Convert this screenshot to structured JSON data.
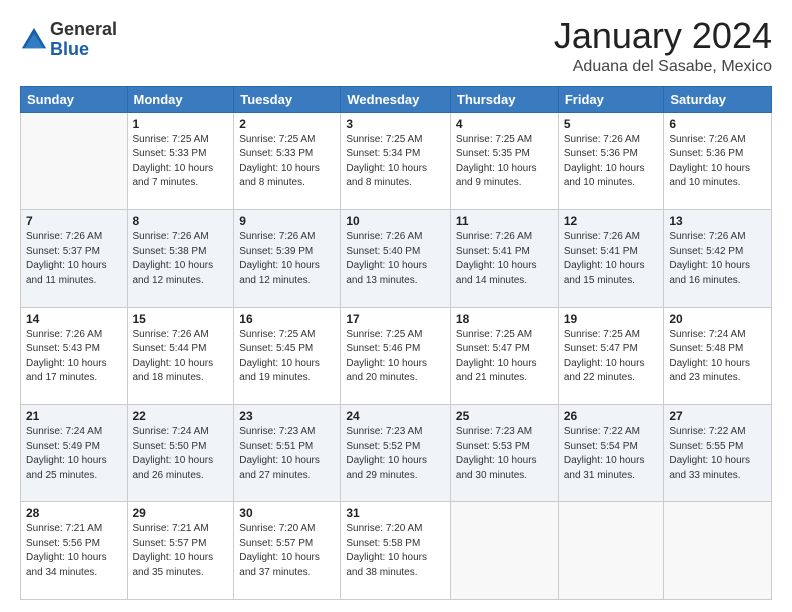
{
  "logo": {
    "general": "General",
    "blue": "Blue"
  },
  "header": {
    "month": "January 2024",
    "location": "Aduana del Sasabe, Mexico"
  },
  "weekdays": [
    "Sunday",
    "Monday",
    "Tuesday",
    "Wednesday",
    "Thursday",
    "Friday",
    "Saturday"
  ],
  "weeks": [
    [
      {
        "day": "",
        "info": ""
      },
      {
        "day": "1",
        "info": "Sunrise: 7:25 AM\nSunset: 5:33 PM\nDaylight: 10 hours\nand 7 minutes."
      },
      {
        "day": "2",
        "info": "Sunrise: 7:25 AM\nSunset: 5:33 PM\nDaylight: 10 hours\nand 8 minutes."
      },
      {
        "day": "3",
        "info": "Sunrise: 7:25 AM\nSunset: 5:34 PM\nDaylight: 10 hours\nand 8 minutes."
      },
      {
        "day": "4",
        "info": "Sunrise: 7:25 AM\nSunset: 5:35 PM\nDaylight: 10 hours\nand 9 minutes."
      },
      {
        "day": "5",
        "info": "Sunrise: 7:26 AM\nSunset: 5:36 PM\nDaylight: 10 hours\nand 10 minutes."
      },
      {
        "day": "6",
        "info": "Sunrise: 7:26 AM\nSunset: 5:36 PM\nDaylight: 10 hours\nand 10 minutes."
      }
    ],
    [
      {
        "day": "7",
        "info": "Sunrise: 7:26 AM\nSunset: 5:37 PM\nDaylight: 10 hours\nand 11 minutes."
      },
      {
        "day": "8",
        "info": "Sunrise: 7:26 AM\nSunset: 5:38 PM\nDaylight: 10 hours\nand 12 minutes."
      },
      {
        "day": "9",
        "info": "Sunrise: 7:26 AM\nSunset: 5:39 PM\nDaylight: 10 hours\nand 12 minutes."
      },
      {
        "day": "10",
        "info": "Sunrise: 7:26 AM\nSunset: 5:40 PM\nDaylight: 10 hours\nand 13 minutes."
      },
      {
        "day": "11",
        "info": "Sunrise: 7:26 AM\nSunset: 5:41 PM\nDaylight: 10 hours\nand 14 minutes."
      },
      {
        "day": "12",
        "info": "Sunrise: 7:26 AM\nSunset: 5:41 PM\nDaylight: 10 hours\nand 15 minutes."
      },
      {
        "day": "13",
        "info": "Sunrise: 7:26 AM\nSunset: 5:42 PM\nDaylight: 10 hours\nand 16 minutes."
      }
    ],
    [
      {
        "day": "14",
        "info": "Sunrise: 7:26 AM\nSunset: 5:43 PM\nDaylight: 10 hours\nand 17 minutes."
      },
      {
        "day": "15",
        "info": "Sunrise: 7:26 AM\nSunset: 5:44 PM\nDaylight: 10 hours\nand 18 minutes."
      },
      {
        "day": "16",
        "info": "Sunrise: 7:25 AM\nSunset: 5:45 PM\nDaylight: 10 hours\nand 19 minutes."
      },
      {
        "day": "17",
        "info": "Sunrise: 7:25 AM\nSunset: 5:46 PM\nDaylight: 10 hours\nand 20 minutes."
      },
      {
        "day": "18",
        "info": "Sunrise: 7:25 AM\nSunset: 5:47 PM\nDaylight: 10 hours\nand 21 minutes."
      },
      {
        "day": "19",
        "info": "Sunrise: 7:25 AM\nSunset: 5:47 PM\nDaylight: 10 hours\nand 22 minutes."
      },
      {
        "day": "20",
        "info": "Sunrise: 7:24 AM\nSunset: 5:48 PM\nDaylight: 10 hours\nand 23 minutes."
      }
    ],
    [
      {
        "day": "21",
        "info": "Sunrise: 7:24 AM\nSunset: 5:49 PM\nDaylight: 10 hours\nand 25 minutes."
      },
      {
        "day": "22",
        "info": "Sunrise: 7:24 AM\nSunset: 5:50 PM\nDaylight: 10 hours\nand 26 minutes."
      },
      {
        "day": "23",
        "info": "Sunrise: 7:23 AM\nSunset: 5:51 PM\nDaylight: 10 hours\nand 27 minutes."
      },
      {
        "day": "24",
        "info": "Sunrise: 7:23 AM\nSunset: 5:52 PM\nDaylight: 10 hours\nand 29 minutes."
      },
      {
        "day": "25",
        "info": "Sunrise: 7:23 AM\nSunset: 5:53 PM\nDaylight: 10 hours\nand 30 minutes."
      },
      {
        "day": "26",
        "info": "Sunrise: 7:22 AM\nSunset: 5:54 PM\nDaylight: 10 hours\nand 31 minutes."
      },
      {
        "day": "27",
        "info": "Sunrise: 7:22 AM\nSunset: 5:55 PM\nDaylight: 10 hours\nand 33 minutes."
      }
    ],
    [
      {
        "day": "28",
        "info": "Sunrise: 7:21 AM\nSunset: 5:56 PM\nDaylight: 10 hours\nand 34 minutes."
      },
      {
        "day": "29",
        "info": "Sunrise: 7:21 AM\nSunset: 5:57 PM\nDaylight: 10 hours\nand 35 minutes."
      },
      {
        "day": "30",
        "info": "Sunrise: 7:20 AM\nSunset: 5:57 PM\nDaylight: 10 hours\nand 37 minutes."
      },
      {
        "day": "31",
        "info": "Sunrise: 7:20 AM\nSunset: 5:58 PM\nDaylight: 10 hours\nand 38 minutes."
      },
      {
        "day": "",
        "info": ""
      },
      {
        "day": "",
        "info": ""
      },
      {
        "day": "",
        "info": ""
      }
    ]
  ]
}
